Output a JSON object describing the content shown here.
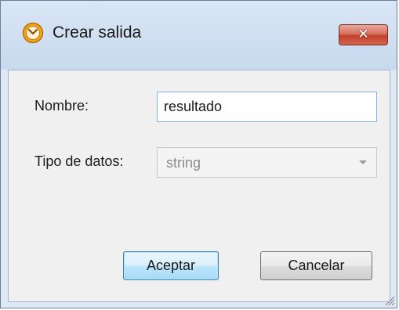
{
  "window": {
    "title": "Crear salida",
    "close_glyph": "✕",
    "icon": "app-clock-icon"
  },
  "form": {
    "name_label": "Nombre:",
    "name_value": "resultado",
    "type_label": "Tipo de datos:",
    "type_value": "string"
  },
  "buttons": {
    "ok_label": "Aceptar",
    "cancel_label": "Cancelar"
  },
  "colors": {
    "accent": "#3c7fb1",
    "close_button": "#c23f2a",
    "app_icon": "#f2a31b"
  }
}
